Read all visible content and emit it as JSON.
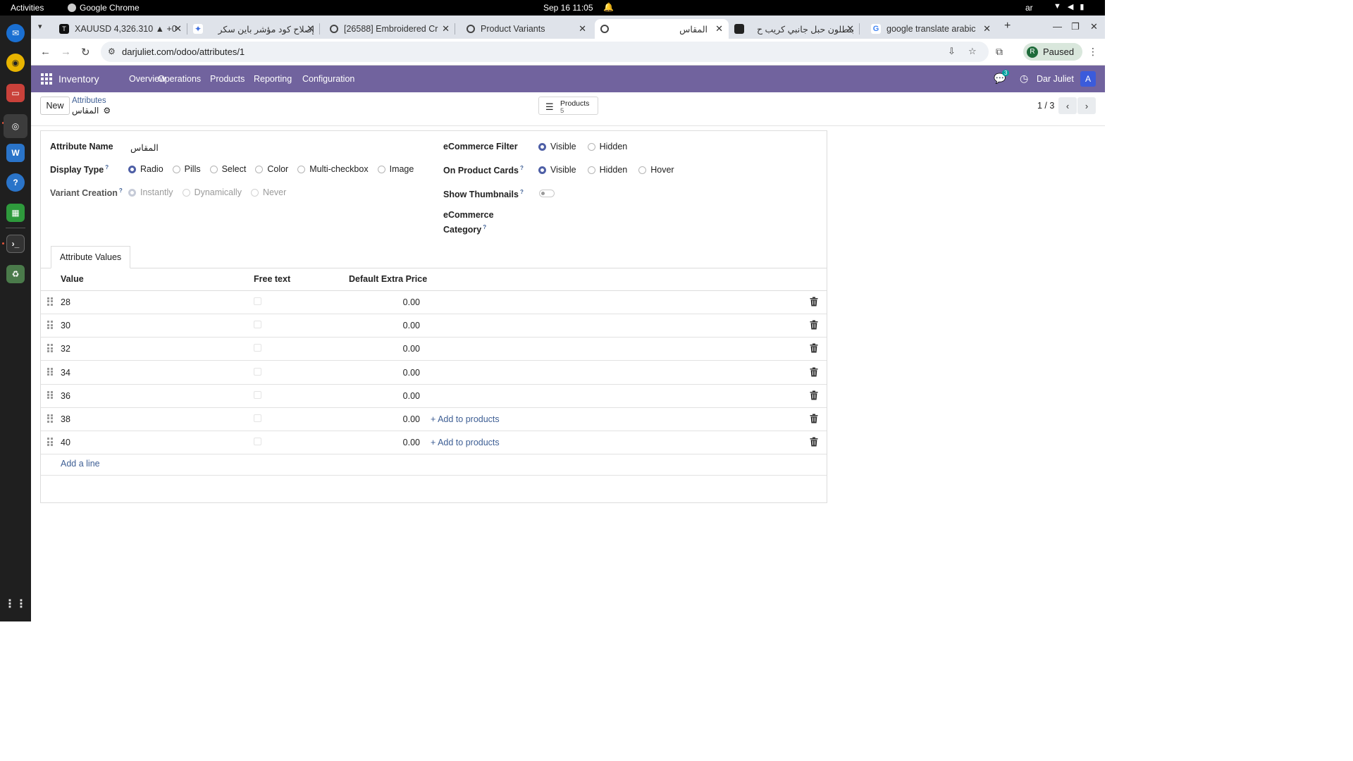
{
  "system": {
    "activities": "Activities",
    "app_name": "Google Chrome",
    "clock": "Sep 16  11:05",
    "language": "ar"
  },
  "browser": {
    "tabs": [
      {
        "title": "XAUUSD 4,326.310 ▲ +0",
        "icon": "tradingview-icon"
      },
      {
        "title": "إصلاح كود مؤشر باين سكر",
        "icon": "gemini-icon"
      },
      {
        "title": "[26588] Embroidered Cr",
        "icon": "odoo-icon"
      },
      {
        "title": "Product Variants",
        "icon": "odoo-icon"
      },
      {
        "title": "المقاس",
        "icon": "odoo-icon"
      },
      {
        "title": "بنطلون حبل جانبي كريب ح",
        "icon": "site-icon"
      },
      {
        "title": "google translate arabic",
        "icon": "google-icon"
      }
    ],
    "active_tab": 4,
    "url": "darjuliet.com/odoo/attributes/1",
    "profile_initial": "R",
    "profile_label": "Paused"
  },
  "odoo": {
    "app_name": "Inventory",
    "menu": [
      "Overview",
      "Operations",
      "Products",
      "Reporting",
      "Configuration"
    ],
    "chat_badge": "3",
    "user_name": "Dar Juliet",
    "avatar_initial": "A",
    "accent_color": "#71639e"
  },
  "control": {
    "new_label": "New",
    "breadcrumb_parent": "Attributes",
    "breadcrumb_current": "المقاس",
    "smart_button_label": "Products",
    "smart_button_value": "5",
    "pager": "1 / 3"
  },
  "form": {
    "attribute_name_label": "Attribute Name",
    "attribute_name_value": "المقاس",
    "display_type_label": "Display Type",
    "display_type_options": [
      "Radio",
      "Pills",
      "Select",
      "Color",
      "Multi-checkbox",
      "Image"
    ],
    "display_type_selected": "Radio",
    "variant_creation_label": "Variant Creation",
    "variant_creation_options": [
      "Instantly",
      "Dynamically",
      "Never"
    ],
    "variant_creation_selected": "Instantly",
    "ecommerce_filter_label": "eCommerce Filter",
    "ecommerce_filter_options": [
      "Visible",
      "Hidden"
    ],
    "ecommerce_filter_selected": "Visible",
    "product_cards_label": "On Product Cards",
    "product_cards_options": [
      "Visible",
      "Hidden",
      "Hover"
    ],
    "product_cards_selected": "Visible",
    "show_thumbnails_label": "Show Thumbnails",
    "show_thumbnails_on": false,
    "ecommerce_category_label_1": "eCommerce",
    "ecommerce_category_label_2": "Category"
  },
  "values_tab": {
    "tab_label": "Attribute Values",
    "columns": [
      "Value",
      "Free text",
      "Default Extra Price"
    ],
    "rows": [
      {
        "value": "28",
        "free_text": false,
        "price": "0.00",
        "action": ""
      },
      {
        "value": "30",
        "free_text": false,
        "price": "0.00",
        "action": ""
      },
      {
        "value": "32",
        "free_text": false,
        "price": "0.00",
        "action": ""
      },
      {
        "value": "34",
        "free_text": false,
        "price": "0.00",
        "action": ""
      },
      {
        "value": "36",
        "free_text": false,
        "price": "0.00",
        "action": ""
      },
      {
        "value": "38",
        "free_text": false,
        "price": "0.00",
        "action": "Add to products"
      },
      {
        "value": "40",
        "free_text": false,
        "price": "0.00",
        "action": "Add to products"
      }
    ],
    "add_line_label": "Add a line"
  }
}
